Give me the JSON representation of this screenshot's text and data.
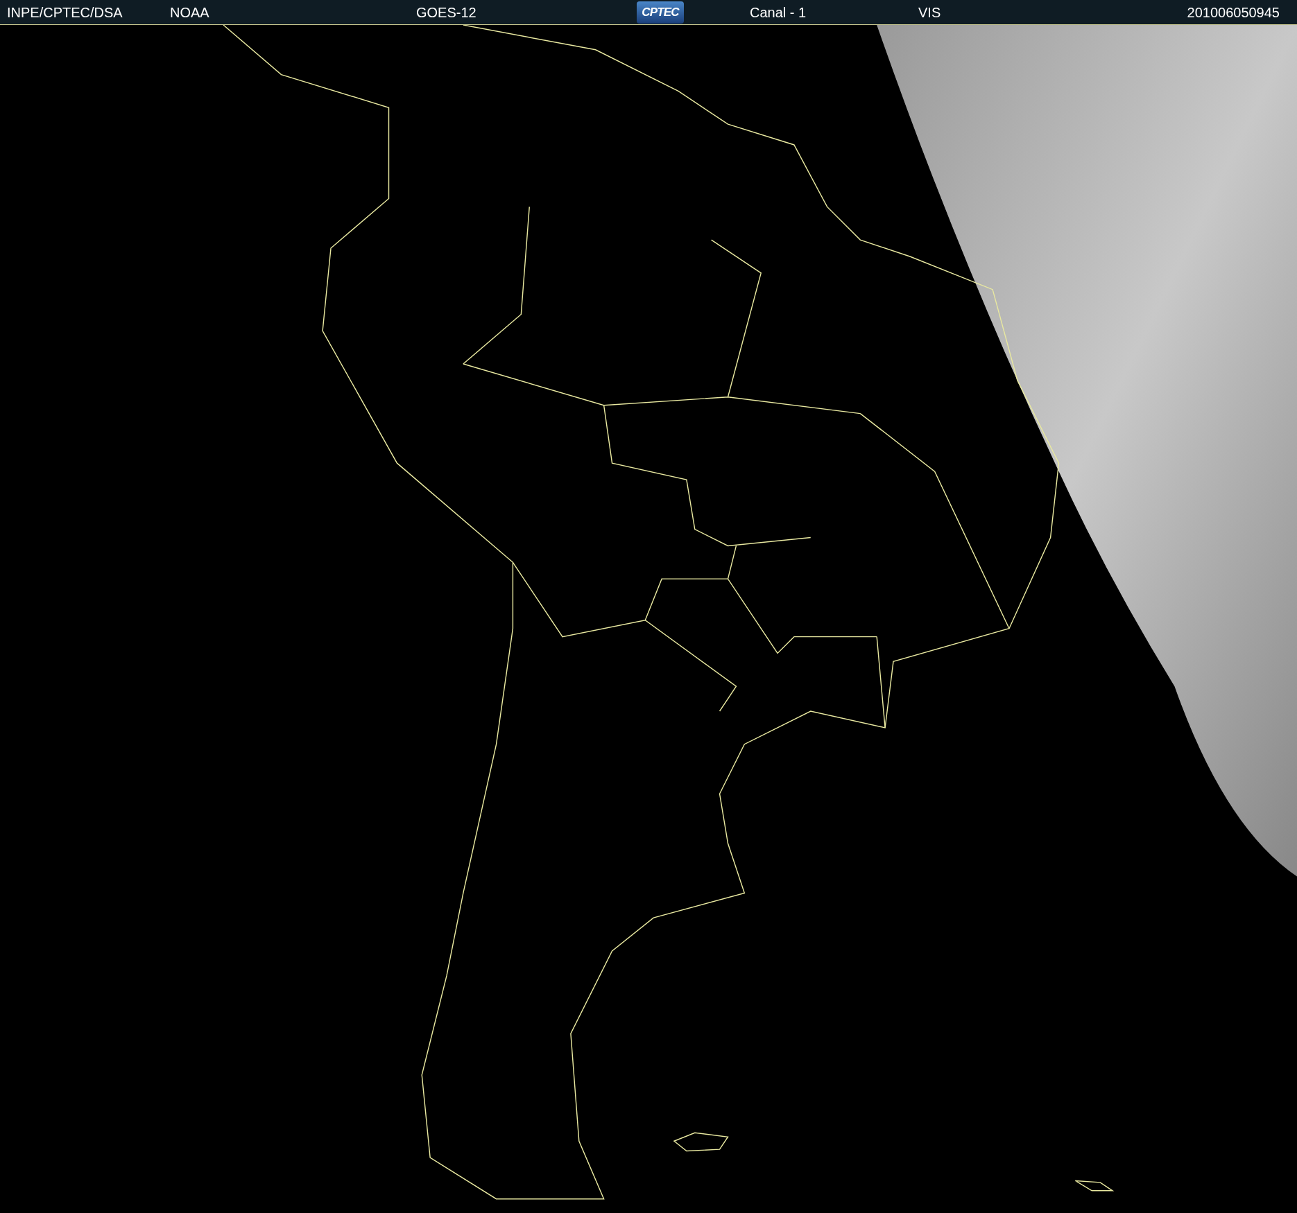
{
  "header": {
    "source": "INPE/CPTEC/DSA",
    "agency": "NOAA",
    "satellite": "GOES-12",
    "logo": "CPTEC",
    "channel": "Canal - 1",
    "band": "VIS",
    "timestamp": "201006050945"
  }
}
